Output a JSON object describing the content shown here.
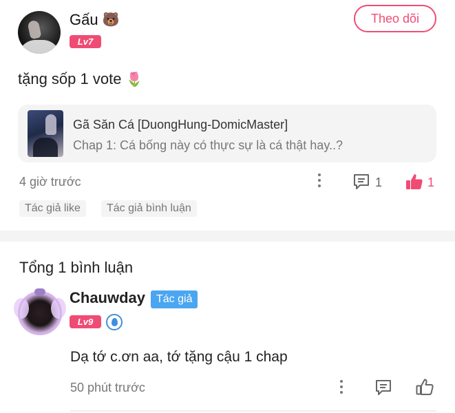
{
  "post": {
    "author": {
      "name": "Gấu",
      "emoji": "🐻",
      "level": "Lv7"
    },
    "follow_label": "Theo dõi",
    "content": "tặng sốp 1 vote",
    "content_emoji": "🌷",
    "manga": {
      "title": "Gã Săn Cá [DuongHung-DomicMaster]",
      "chapter": "Chap 1: Cá bống này có thực sự là cá thật hay..?"
    },
    "time": "4 giờ trước",
    "comment_count": "1",
    "like_count": "1",
    "tags": [
      "Tác giả like",
      "Tác giả bình luận"
    ],
    "accent_color": "#ef4c74"
  },
  "comments_section": {
    "total_label": "Tổng 1 bình luận",
    "comment": {
      "author": "Chauwday",
      "author_badge": "Tác giả",
      "level": "Lv9",
      "text": "Dạ tớ c.ơn aa, tớ tặng cậu 1 chap",
      "time": "50 phút trước",
      "badge_color": "#4aa6f0"
    }
  }
}
